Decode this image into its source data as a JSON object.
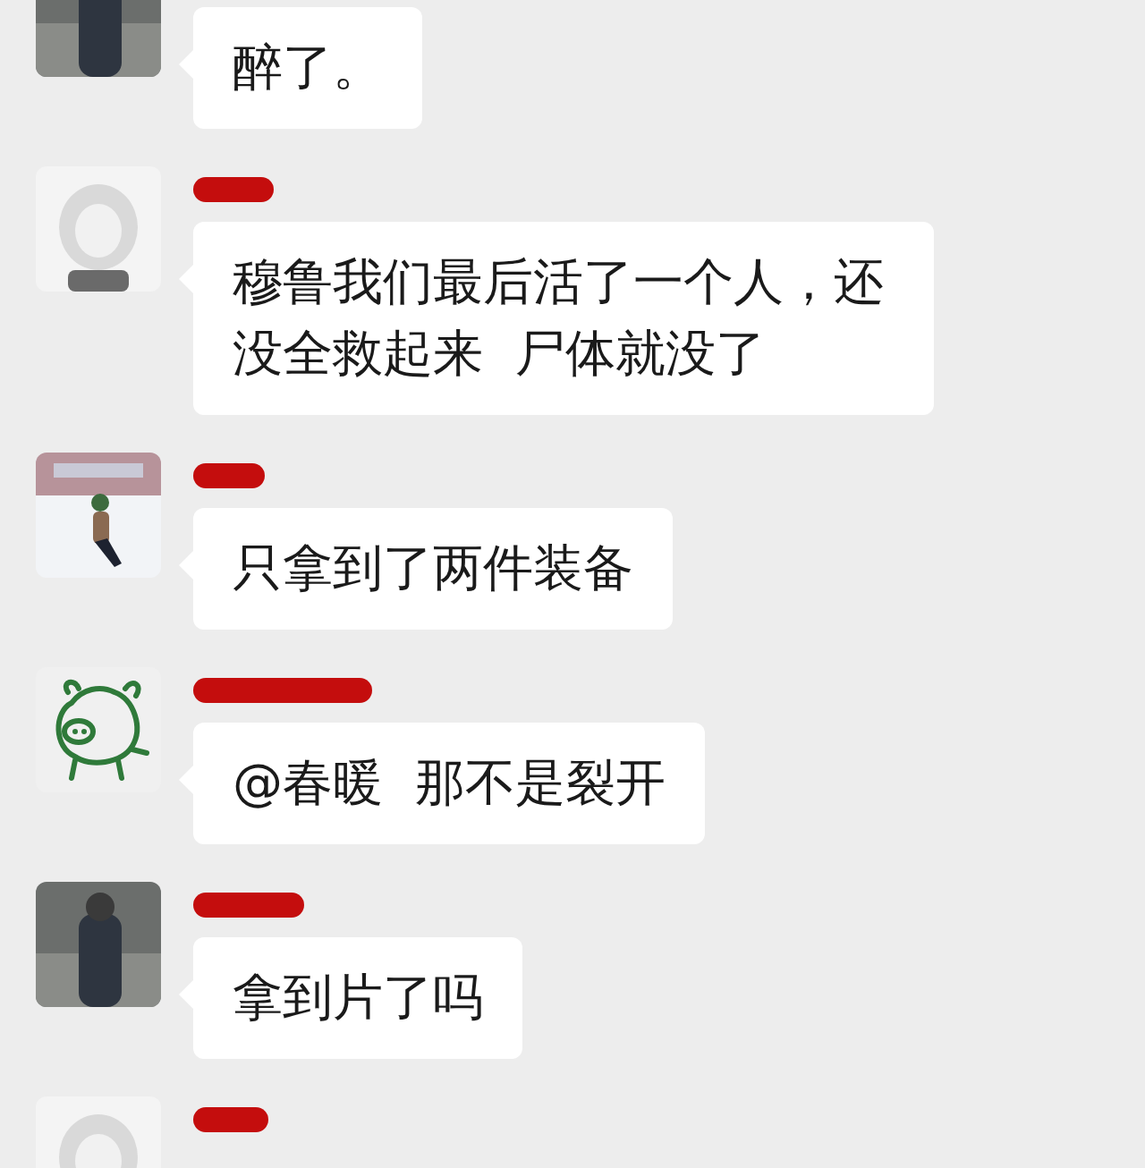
{
  "messages": [
    {
      "text": "醉了。"
    },
    {
      "name_redacted": true,
      "text": "穆鲁我们最后活了一个人，还没全救起来  尸体就没了"
    },
    {
      "name_redacted": true,
      "text": "只拿到了两件装备"
    },
    {
      "avatar": {
        "kind": "drawing"
      },
      "name_redacted": true,
      "text": "@春暖  那不是裂开"
    },
    {
      "name_redacted": true,
      "text": "拿到片了吗"
    },
    {
      "name_redacted": true
    }
  ]
}
